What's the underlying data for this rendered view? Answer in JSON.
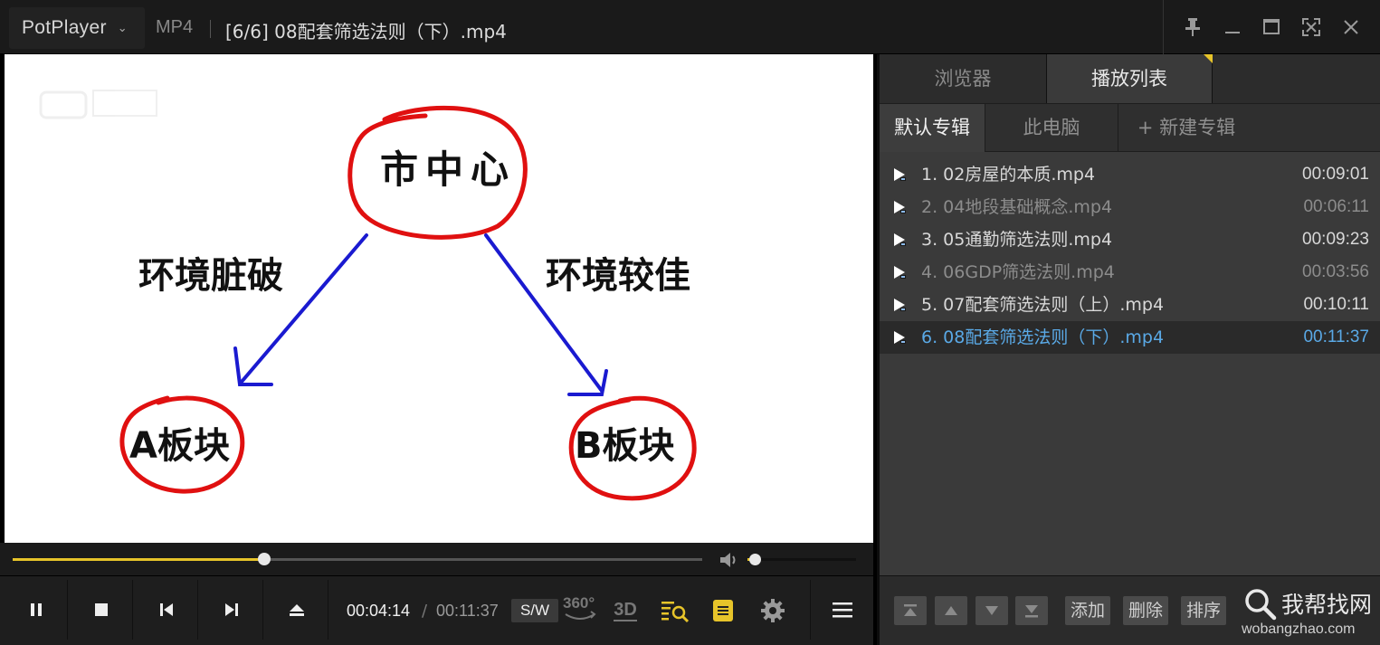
{
  "titlebar": {
    "app_name": "PotPlayer",
    "format": "MP4",
    "file_title": "[6/6] 08配套筛选法则（下）.mp4",
    "window_controls": [
      "pin-icon",
      "minimize-icon",
      "maximize-icon",
      "fullscreen-icon",
      "close-icon"
    ]
  },
  "video": {
    "top_node": "市中心",
    "left_label": "环境脏破",
    "right_label": "环境较佳",
    "left_node": "A板块",
    "right_node": "B板块",
    "colors": {
      "circle": "#e01010",
      "arrow": "#1a1ad0",
      "text": "#111111"
    }
  },
  "seek": {
    "progress": 0.3645,
    "volume": 0.07
  },
  "controls": {
    "buttons": [
      "pause-icon",
      "stop-icon",
      "previous-icon",
      "next-icon",
      "eject-icon"
    ],
    "current_time": "00:04:14",
    "separator": "/",
    "total_time": "00:11:37",
    "sw_label": "S/W",
    "label_360": "360°",
    "label_3d": "3D",
    "accent": "#e7c42a"
  },
  "panel": {
    "tabs": [
      "浏览器",
      "播放列表"
    ],
    "album_tabs": [
      "默认专辑",
      "此电脑",
      "+ 新建专辑"
    ],
    "playlist": [
      {
        "name": "1. 02房屋的本质.mp4",
        "duration": "00:09:01",
        "state": "normal"
      },
      {
        "name": "2. 04地段基础概念.mp4",
        "duration": "00:06:11",
        "state": "dim"
      },
      {
        "name": "3. 05通勤筛选法则.mp4",
        "duration": "00:09:23",
        "state": "normal"
      },
      {
        "name": "4. 06GDP筛选法则.mp4",
        "duration": "00:03:56",
        "state": "dim"
      },
      {
        "name": "5. 07配套筛选法则（上）.mp4",
        "duration": "00:10:11",
        "state": "normal"
      },
      {
        "name": "6. 08配套筛选法则（下）.mp4",
        "duration": "00:11:37",
        "state": "active"
      }
    ],
    "bottom_buttons": {
      "add": "添加",
      "delete": "删除",
      "sort": "排序"
    },
    "watermark": {
      "text": "我帮找网",
      "url": "wobangzhao.com"
    },
    "row_colors": {
      "normal": "#d8d8d8",
      "dim": "#8c8c8c",
      "active": "#5aa9e6"
    }
  }
}
